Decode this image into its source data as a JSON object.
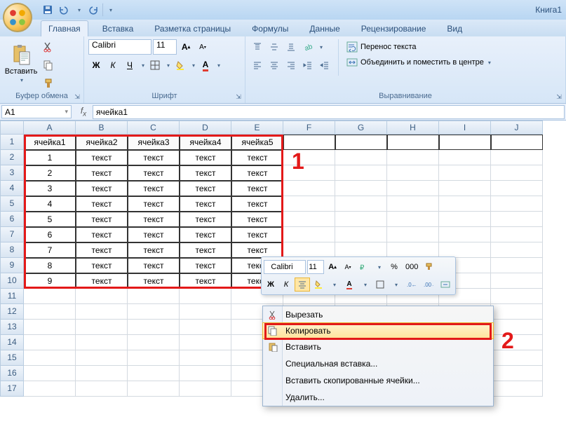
{
  "title": "Книга1",
  "tabs": [
    "Главная",
    "Вставка",
    "Разметка страницы",
    "Формулы",
    "Данные",
    "Рецензирование",
    "Вид"
  ],
  "active_tab_index": 0,
  "clipboard": {
    "paste": "Вставить",
    "group": "Буфер обмена"
  },
  "font": {
    "group": "Шрифт",
    "name": "Calibri",
    "size": "11"
  },
  "alignment": {
    "group": "Выравнивание",
    "wrap": "Перенос текста",
    "merge": "Объединить и поместить в центре"
  },
  "name_box": "A1",
  "formula_bar": "ячейка1",
  "columns": [
    "A",
    "B",
    "C",
    "D",
    "E",
    "F",
    "G",
    "H",
    "I",
    "J"
  ],
  "table": {
    "header": [
      "ячейка1",
      "ячейка2",
      "ячейка3",
      "ячейка4",
      "ячейка5"
    ],
    "rows": [
      [
        "1",
        "текст",
        "текст",
        "текст",
        "текст"
      ],
      [
        "2",
        "текст",
        "текст",
        "текст",
        "текст"
      ],
      [
        "3",
        "текст",
        "текст",
        "текст",
        "текст"
      ],
      [
        "4",
        "текст",
        "текст",
        "текст",
        "текст"
      ],
      [
        "5",
        "текст",
        "текст",
        "текст",
        "текст"
      ],
      [
        "6",
        "текст",
        "текст",
        "текст",
        "текст"
      ],
      [
        "7",
        "текст",
        "текст",
        "текст",
        "текст"
      ],
      [
        "8",
        "текст",
        "текст",
        "текст",
        "текст"
      ],
      [
        "9",
        "текст",
        "текст",
        "текст",
        "текст"
      ]
    ]
  },
  "annotations": {
    "one": "1",
    "two": "2"
  },
  "mini_toolbar": {
    "font": "Calibri",
    "size": "11",
    "percent": "%",
    "zeros": "000"
  },
  "context_menu": [
    "Вырезать",
    "Копировать",
    "Вставить",
    "Специальная вставка...",
    "Вставить скопированные ячейки...",
    "Удалить..."
  ]
}
